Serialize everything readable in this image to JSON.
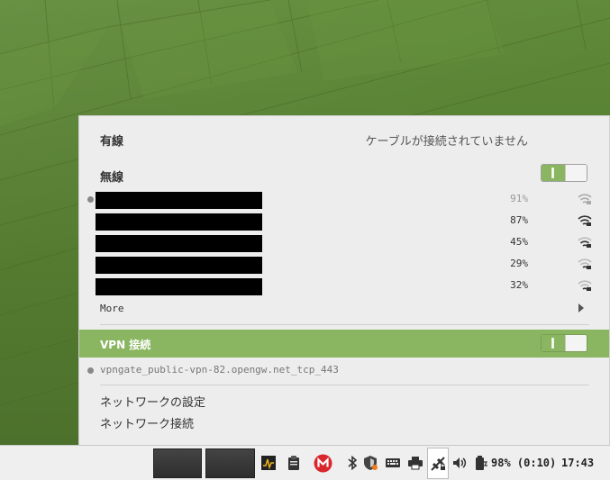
{
  "wired": {
    "title": "有線",
    "status": "ケーブルが接続されていません"
  },
  "wireless": {
    "title": "無線",
    "enabled": true,
    "networks": [
      {
        "ssid": "",
        "signal": "91%",
        "connected": true
      },
      {
        "ssid": "",
        "signal": "87%",
        "connected": false
      },
      {
        "ssid": "",
        "signal": "45%",
        "connected": false
      },
      {
        "ssid": "",
        "signal": "29%",
        "connected": false
      },
      {
        "ssid": "",
        "signal": "32%",
        "connected": false
      }
    ],
    "more_label": "More"
  },
  "vpn": {
    "title": "VPN 接続",
    "enabled": true,
    "connection": "vpngate_public-vpn-82.opengw.net_tcp_443"
  },
  "menu": {
    "network_settings": "ネットワークの設定",
    "network_connections": "ネットワーク接続"
  },
  "taskbar": {
    "battery": "98% (0:10)",
    "clock": "17:43",
    "icons": [
      "system-monitor-icon",
      "clipboard-icon",
      "mega-icon",
      "bluetooth-icon",
      "update-shield-icon",
      "keyboard-icon",
      "printer-icon",
      "network-icon",
      "volume-icon",
      "battery-icon"
    ]
  },
  "colors": {
    "accent": "#8ab561",
    "wallpaper": "#5a7e35",
    "mega": "#d9272e"
  }
}
